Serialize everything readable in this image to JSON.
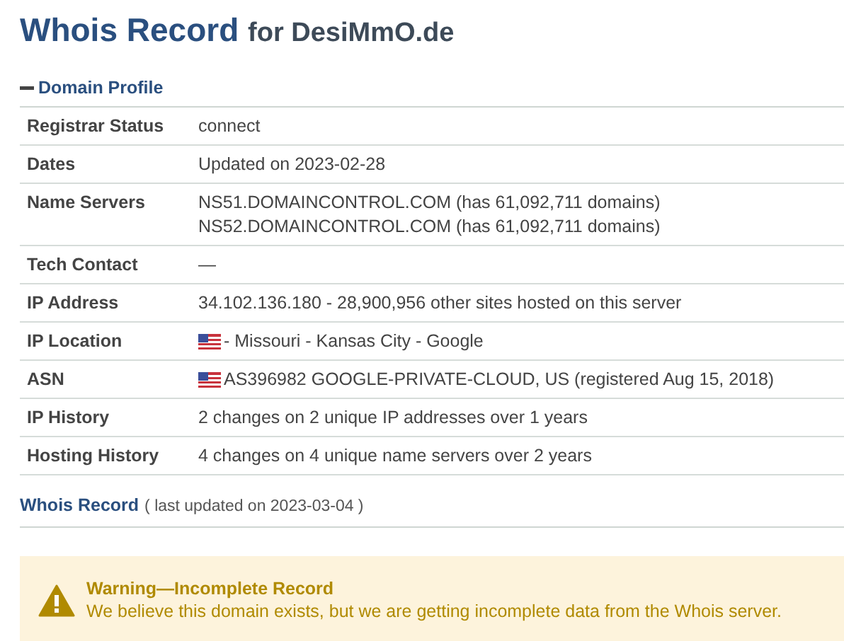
{
  "title": {
    "main": "Whois Record",
    "suffix": "for DesiMmO.de"
  },
  "domain_profile": {
    "heading": "Domain Profile",
    "expanded": true,
    "rows": [
      {
        "label": "Registrar Status",
        "lines": [
          {
            "text": "connect",
            "flag": false
          }
        ]
      },
      {
        "label": "Dates",
        "lines": [
          {
            "text": "Updated on 2023-02-28",
            "flag": false
          }
        ]
      },
      {
        "label": "Name Servers",
        "lines": [
          {
            "text": "NS51.DOMAINCONTROL.COM (has 61,092,711 domains)",
            "flag": false
          },
          {
            "text": "NS52.DOMAINCONTROL.COM (has 61,092,711 domains)",
            "flag": false
          }
        ]
      },
      {
        "label": "Tech Contact",
        "lines": [
          {
            "text": "—",
            "flag": false
          }
        ]
      },
      {
        "label": "IP Address",
        "lines": [
          {
            "text": "34.102.136.180 - 28,900,956 other sites hosted on this server",
            "flag": false
          }
        ]
      },
      {
        "label": "IP Location",
        "lines": [
          {
            "text": "- Missouri - Kansas City - Google",
            "flag": true
          }
        ]
      },
      {
        "label": "ASN",
        "lines": [
          {
            "text": "AS396982 GOOGLE-PRIVATE-CLOUD, US (registered Aug 15, 2018)",
            "flag": true
          }
        ]
      },
      {
        "label": "IP History",
        "lines": [
          {
            "text": "2 changes on 2 unique IP addresses over 1 years",
            "flag": false
          }
        ]
      },
      {
        "label": "Hosting History",
        "lines": [
          {
            "text": "4 changes on 4 unique name servers over 2 years",
            "flag": false
          }
        ]
      }
    ]
  },
  "whois_record": {
    "heading": "Whois Record",
    "note": "( last updated on 2023-03-04 )"
  },
  "warning": {
    "title": "Warning—Incomplete Record",
    "message": "We believe this domain exists, but we are getting incomplete data from the Whois server."
  }
}
